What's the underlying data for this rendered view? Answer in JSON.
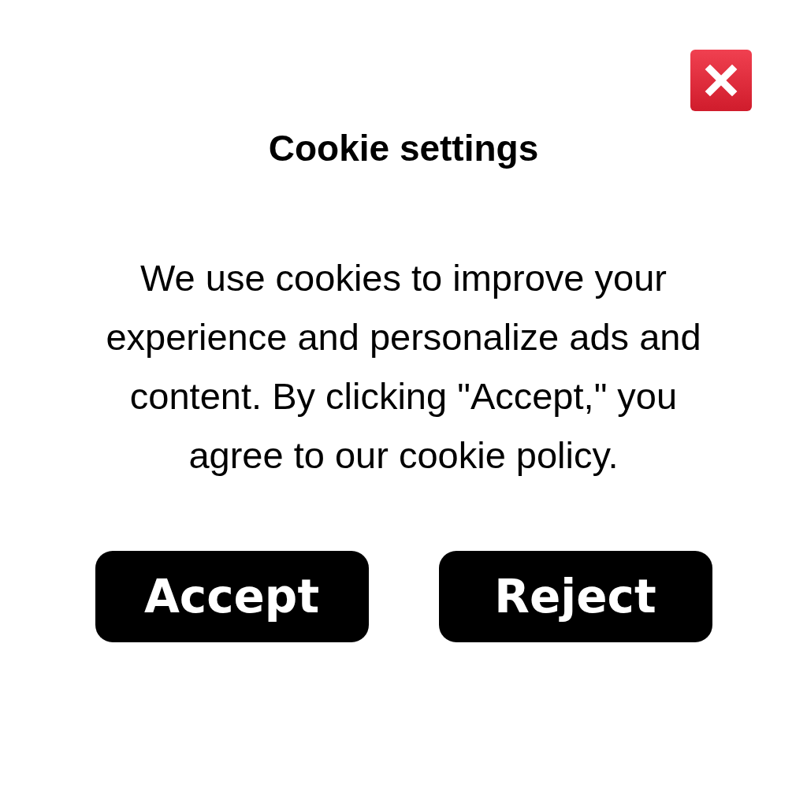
{
  "dialog": {
    "title": "Cookie settings",
    "message": "We use cookies to improve your experience and personalize ads and content. By clicking \"Accept,\" you agree to our cookie policy.",
    "close": {
      "kind": "close"
    },
    "buttons": [
      {
        "label": "Accept"
      },
      {
        "label": "Reject"
      }
    ]
  }
}
